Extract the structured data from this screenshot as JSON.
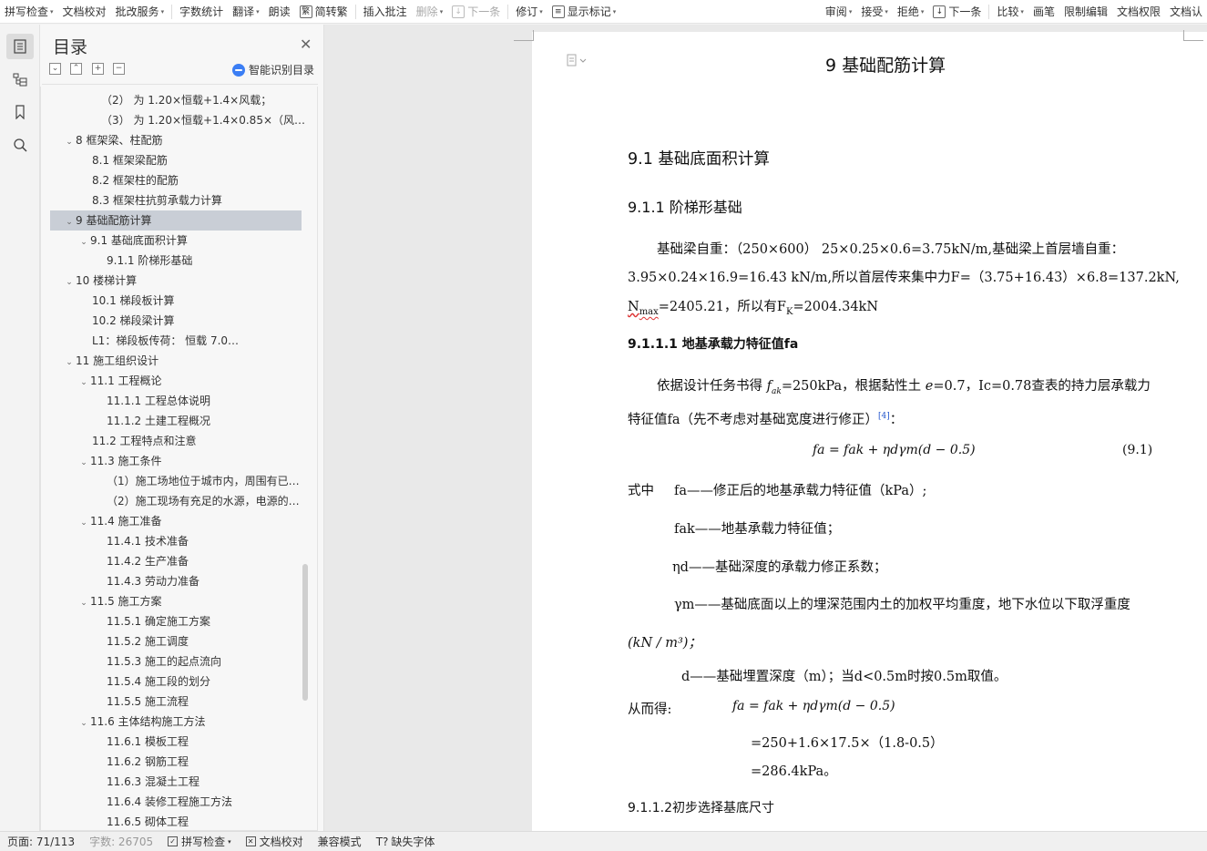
{
  "toolbar": {
    "items": [
      {
        "label": "拼写检查",
        "caret": true,
        "disabled": false
      },
      {
        "label": "文档校对",
        "caret": false,
        "disabled": false
      },
      {
        "label": "批改服务",
        "caret": true,
        "disabled": false
      },
      {
        "label": "字数统计",
        "caret": false,
        "disabled": false
      },
      {
        "label": "翻译",
        "caret": true,
        "disabled": false
      },
      {
        "label": "朗读",
        "caret": false,
        "disabled": false
      },
      {
        "label": "简转繁",
        "caret": false,
        "disabled": false,
        "icon": "繁"
      },
      {
        "label": "插入批注",
        "caret": false,
        "disabled": false
      },
      {
        "label": "删除",
        "caret": true,
        "disabled": true
      },
      {
        "label": "下一条",
        "caret": false,
        "disabled": true,
        "icon": "↓"
      },
      {
        "label": "修订",
        "caret": true,
        "disabled": false
      },
      {
        "label": "显示标记",
        "caret": true,
        "disabled": false,
        "icon": "≡"
      },
      {
        "label": "审阅",
        "caret": true,
        "disabled": false
      },
      {
        "label": "接受",
        "caret": true,
        "disabled": false
      },
      {
        "label": "拒绝",
        "caret": true,
        "disabled": false
      },
      {
        "label": "下一条",
        "caret": false,
        "disabled": false,
        "icon": "↓"
      },
      {
        "label": "比较",
        "caret": true,
        "disabled": false
      },
      {
        "label": "画笔",
        "caret": false,
        "disabled": false
      },
      {
        "label": "限制编辑",
        "caret": false,
        "disabled": false
      },
      {
        "label": "文档权限",
        "caret": false,
        "disabled": false
      },
      {
        "label": "文档认",
        "caret": false,
        "disabled": false
      }
    ]
  },
  "nav": {
    "title": "目录",
    "smart_label": "智能识别目录",
    "items": [
      {
        "text": "（2）  为 1.20×恒载+1.4×风载；",
        "indent": 56,
        "chev": ""
      },
      {
        "text": "（3）  为 1.20×恒载+1.4×0.85×（风…",
        "indent": 56,
        "chev": ""
      },
      {
        "text": "8   框架梁、柱配筋",
        "indent": 14,
        "chev": "v"
      },
      {
        "text": "8.1    框架梁配筋",
        "indent": 46,
        "chev": ""
      },
      {
        "text": "8.2    框架柱的配筋",
        "indent": 46,
        "chev": ""
      },
      {
        "text": "8.3 框架柱抗剪承载力计算",
        "indent": 46,
        "chev": ""
      },
      {
        "text": "9   基础配筋计算",
        "indent": 14,
        "chev": "v",
        "selected": true
      },
      {
        "text": "9.1    基础底面积计算",
        "indent": 30,
        "chev": "v"
      },
      {
        "text": "9.1.1    阶梯形基础",
        "indent": 62,
        "chev": ""
      },
      {
        "text": "10    楼梯计算",
        "indent": 14,
        "chev": "v"
      },
      {
        "text": "10.1      梯段板计算",
        "indent": 46,
        "chev": ""
      },
      {
        "text": "10.2    梯段梁计算",
        "indent": 46,
        "chev": ""
      },
      {
        "text": "L1：梯段板传荷：        恒载              7.0…",
        "indent": 46,
        "chev": ""
      },
      {
        "text": "11    施工组织设计",
        "indent": 14,
        "chev": "v"
      },
      {
        "text": "11.1    工程概论",
        "indent": 30,
        "chev": "v"
      },
      {
        "text": "11.1.1 工程总体说明",
        "indent": 62,
        "chev": ""
      },
      {
        "text": "11.1.2 土建工程概况",
        "indent": 62,
        "chev": ""
      },
      {
        "text": "11.2    工程特点和注意",
        "indent": 46,
        "chev": ""
      },
      {
        "text": "11.3    施工条件",
        "indent": 30,
        "chev": "v"
      },
      {
        "text": "（1）施工场地位于城市内，周围有已…",
        "indent": 62,
        "chev": ""
      },
      {
        "text": "（2）施工现场有充足的水源，电源的…",
        "indent": 62,
        "chev": ""
      },
      {
        "text": "11.4    施工准备",
        "indent": 30,
        "chev": "v"
      },
      {
        "text": "11.4.1 技术准备",
        "indent": 62,
        "chev": ""
      },
      {
        "text": "11.4.2 生产准备",
        "indent": 62,
        "chev": ""
      },
      {
        "text": "11.4.3 劳动力准备",
        "indent": 62,
        "chev": ""
      },
      {
        "text": "11.5    施工方案",
        "indent": 30,
        "chev": "v"
      },
      {
        "text": "11.5.1 确定施工方案",
        "indent": 62,
        "chev": ""
      },
      {
        "text": "11.5.2 施工调度",
        "indent": 62,
        "chev": ""
      },
      {
        "text": "11.5.3 施工的起点流向",
        "indent": 62,
        "chev": ""
      },
      {
        "text": "11.5.4 施工段的划分",
        "indent": 62,
        "chev": ""
      },
      {
        "text": "11.5.5 施工流程",
        "indent": 62,
        "chev": ""
      },
      {
        "text": "11.6    主体结构施工方法",
        "indent": 30,
        "chev": "v"
      },
      {
        "text": "11.6.1 模板工程",
        "indent": 62,
        "chev": ""
      },
      {
        "text": "11.6.2  钢筋工程",
        "indent": 62,
        "chev": ""
      },
      {
        "text": "11.6.3 混凝土工程",
        "indent": 62,
        "chev": ""
      },
      {
        "text": "11.6.4 装修工程施工方法",
        "indent": 62,
        "chev": ""
      },
      {
        "text": "11.6.5 砌体工程",
        "indent": 62,
        "chev": ""
      }
    ]
  },
  "doc": {
    "h1": "9    基础配筋计算",
    "h2": "9.1    基础底面积计算",
    "h3": "9.1.1    阶梯形基础",
    "p1_line1": "基础梁自重：（250×600）   25×0.25×0.6=3.75kN/m,基础梁上首层墙自重：",
    "p1_line2": "3.95×0.24×16.9=16.43 kN/m,所以首层传来集中力F=（3.75+16.43）×6.8=137.2kN,",
    "p1_line3_a": "N",
    "p1_line3_sub": "max",
    "p1_line3_b": "=2405.21，所以有F",
    "p1_line3_sub2": "K",
    "p1_line3_c": "=2004.34kN",
    "h4": "9.1.1.1  地基承载力特征值fa",
    "p2_line1_a": "依据设计任务书得 ",
    "p2_line1_f": "f",
    "p2_line1_fsub": "ak",
    "p2_line1_b": "=250kPa，根据黏性土 ",
    "p2_line1_e": "e",
    "p2_line1_c": "=0.7，Ic=0.78查表的持力层承载力",
    "p2_line2": "特征值fa（先不考虑对基础宽度进行修正）",
    "p2_ref": "[4]",
    "p2_line2_end": "：",
    "formula": "fa = fak + ηdγm(d − 0.5)",
    "formula_no": "(9.1)",
    "def_lead": "式中",
    "def1": "fa——修正后的地基承载力特征值（kPa）;",
    "def2": "fak——地基承载力特征值；",
    "def3": "ηd——基础深度的承载力修正系数；",
    "def4": "γm——基础底面以上的埋深范围内土的加权平均重度，地下水位以下取浮重度",
    "def4_unit": "(kN / m³)；",
    "def5": "d——基础埋置深度（m）；当d<0.5m时按0.5m取值。",
    "result_lead": "从而得:",
    "result_formula": "fa = fak + ηdγm(d − 0.5)",
    "calc1": "=250+1.6×17.5×（1.8-0.5）",
    "calc2": "=286.4kPa。",
    "h5": "9.1.1.2初步选择基底尺寸"
  },
  "status": {
    "page": "页面: 71/113",
    "words": "字数: 26705",
    "spell": "拼写检查",
    "proof": "文档校对",
    "compat": "兼容模式",
    "missing_font": "缺失字体"
  }
}
